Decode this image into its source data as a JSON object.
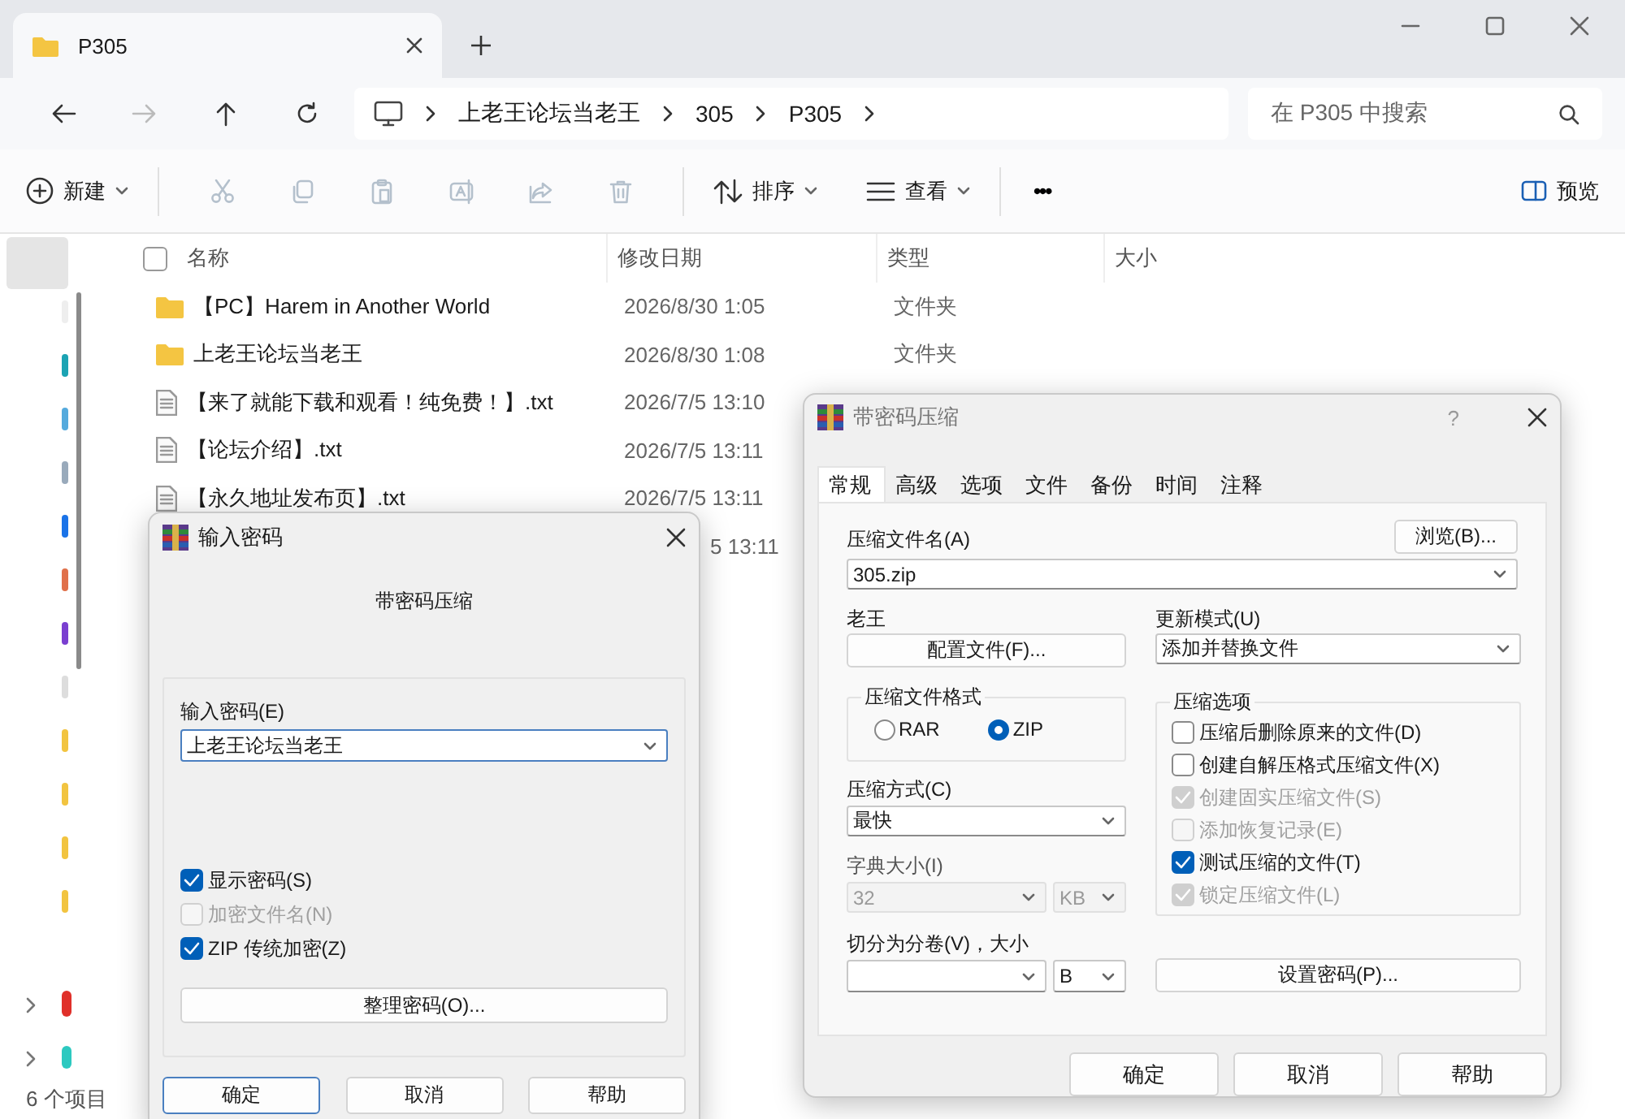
{
  "explorer": {
    "tab": {
      "title": "P305"
    },
    "nav_buttons": [
      {
        "kind": "back",
        "disabled": false
      },
      {
        "kind": "forward",
        "disabled": true
      },
      {
        "kind": "up",
        "disabled": false
      },
      {
        "kind": "refresh",
        "disabled": false
      }
    ],
    "breadcrumb": [
      "上老王论坛当老王",
      "305",
      "P305"
    ],
    "search": {
      "placeholder": "在 P305 中搜索"
    },
    "toolbar": {
      "new": "新建",
      "tools": [
        {
          "kind": "cut",
          "disabled": true
        },
        {
          "kind": "copy",
          "disabled": true
        },
        {
          "kind": "paste",
          "disabled": true
        },
        {
          "kind": "rename",
          "disabled": true
        },
        {
          "kind": "share",
          "disabled": true
        },
        {
          "kind": "delete",
          "disabled": true
        }
      ],
      "sort": "排序",
      "view": "查看",
      "more": "•••",
      "preview": "预览"
    },
    "columns": [
      "名称",
      "修改日期",
      "类型",
      "大小"
    ],
    "rows": [
      {
        "kind": "folder",
        "name": "【PC】Harem in Another World",
        "date": "2026/8/30 1:05",
        "type": "文件夹"
      },
      {
        "kind": "folder",
        "name": "上老王论坛当老王",
        "date": "2026/8/30 1:08",
        "type": "文件夹"
      },
      {
        "kind": "text",
        "name": "【来了就能下载和观看！纯免费！】.txt",
        "date": "2026/7/5 13:10"
      },
      {
        "kind": "text",
        "name": "【论坛介绍】.txt",
        "date": "2026/7/5 13:11"
      },
      {
        "kind": "text",
        "name": "【永久地址发布页】.txt",
        "date": "2026/7/5 13:11"
      },
      {
        "date": "5 13:11"
      }
    ],
    "select_all": {
      "checked": false
    },
    "status": "6 个项目"
  },
  "password_dialog": {
    "title": "输入密码",
    "heading": "带密码压缩",
    "field_label": "输入密码(E)",
    "password": "上老王论坛当老王",
    "checkboxes": [
      {
        "label": "显示密码(S)",
        "checked": true,
        "disabled": false
      },
      {
        "label": "加密文件名(N)",
        "checked": false,
        "disabled": true
      },
      {
        "label": "ZIP 传统加密(Z)",
        "checked": true,
        "disabled": false
      }
    ],
    "manage_button": "整理密码(O)...",
    "buttons": [
      "确定",
      "取消",
      "帮助"
    ]
  },
  "archive_dialog": {
    "title": "带密码压缩",
    "help": "?",
    "tabs": [
      {
        "label": "常规",
        "selected": true
      },
      {
        "label": "高级",
        "selected": false
      },
      {
        "label": "选项",
        "selected": false
      },
      {
        "label": "文件",
        "selected": false
      },
      {
        "label": "备份",
        "selected": false
      },
      {
        "label": "时间",
        "selected": false
      },
      {
        "label": "注释",
        "selected": false
      }
    ],
    "archive_name_label": "压缩文件名(A)",
    "browse_button": "浏览(B)...",
    "archive_name": "305.zip",
    "profile_label": "老王",
    "profile_button": "配置文件(F)...",
    "update_label": "更新模式(U)",
    "update_mode": "添加并替换文件",
    "format_label": "压缩文件格式",
    "formats": [
      {
        "label": "RAR",
        "selected": false
      },
      {
        "label": "ZIP",
        "selected": true
      }
    ],
    "method_label": "压缩方式(C)",
    "method": "最快",
    "dictionary_label": "字典大小(I)",
    "dictionary": {
      "value": "32",
      "unit": "KB",
      "disabled": true
    },
    "split_label": "切分为分卷(V)，大小",
    "split_unit": "B",
    "options_label": "压缩选项",
    "options": [
      {
        "label": "压缩后删除原来的文件(D)",
        "checked": false,
        "disabled": false
      },
      {
        "label": "创建自解压格式压缩文件(X)",
        "checked": false,
        "disabled": false
      },
      {
        "label": "创建固实压缩文件(S)",
        "checked": true,
        "disabled": true
      },
      {
        "label": "添加恢复记录(E)",
        "checked": false,
        "disabled": true
      },
      {
        "label": "测试压缩的文件(T)",
        "checked": true,
        "disabled": false
      },
      {
        "label": "锁定压缩文件(L)",
        "checked": true,
        "disabled": true
      }
    ],
    "set_password_button": "设置密码(P)...",
    "buttons": [
      "确定",
      "取消",
      "帮助"
    ]
  }
}
